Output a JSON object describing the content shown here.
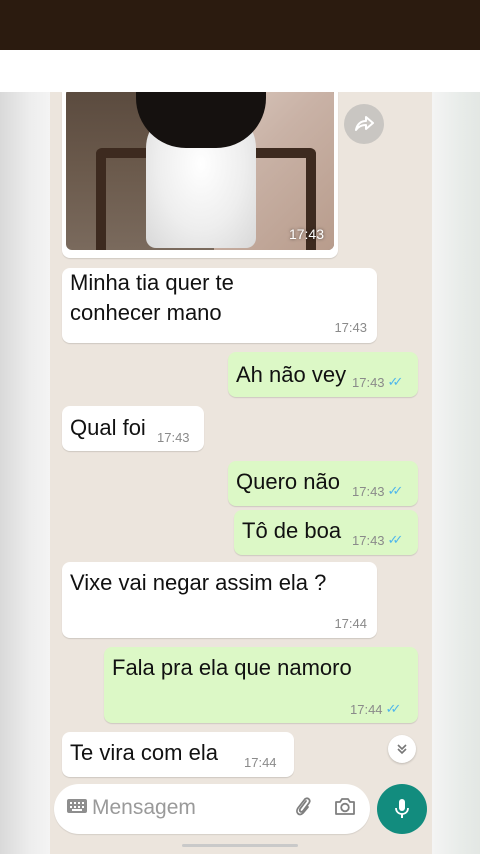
{
  "chat": {
    "photo_time": "17:43",
    "messages": [
      {
        "side": "in",
        "text": "Minha tia quer te\nconhecer mano",
        "time": "17:43"
      },
      {
        "side": "out",
        "text": "Ah não vey",
        "time": "17:43",
        "read": "✓✓"
      },
      {
        "side": "in",
        "text": "Qual foi",
        "time": "17:43"
      },
      {
        "side": "out",
        "text": "Quero não",
        "time": "17:43",
        "read": "✓✓"
      },
      {
        "side": "out",
        "text": "Tô de boa",
        "time": "17:43",
        "read": "✓✓"
      },
      {
        "side": "in",
        "text": "Vixe vai negar assim ela ?",
        "time": "17:44"
      },
      {
        "side": "out",
        "text": "Fala pra ela que namoro",
        "time": "17:44",
        "read": "✓✓"
      },
      {
        "side": "in",
        "text": "Te vira com ela",
        "time": "17:44"
      }
    ]
  },
  "composer": {
    "placeholder": "Mensagem"
  },
  "icons": {
    "forward": "forward-icon",
    "scroll_down": "double-chevron-down-icon",
    "keyboard": "keyboard-icon",
    "attach": "paperclip-icon",
    "camera": "camera-icon",
    "mic": "microphone-icon"
  },
  "colors": {
    "incoming": "#ffffff",
    "outgoing": "#dcf8c6",
    "background": "#ece5dd",
    "read_tick": "#4fb6ec",
    "mic_button": "#128c7e"
  }
}
